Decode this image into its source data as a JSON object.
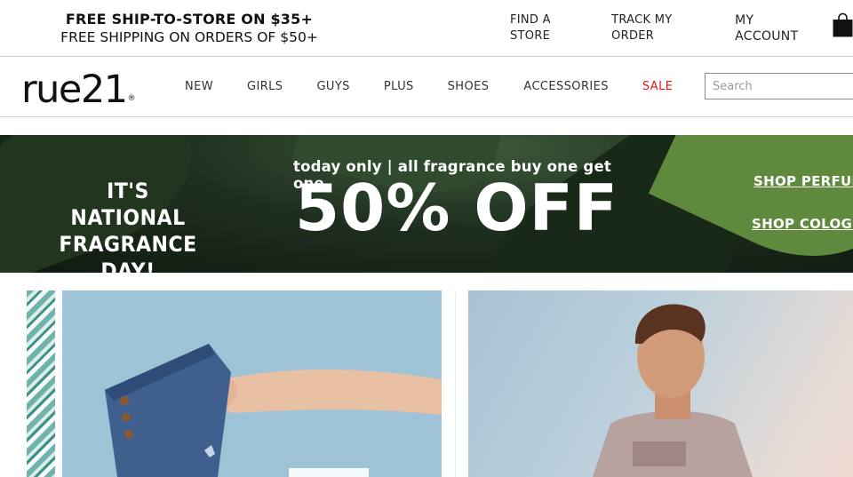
{
  "promo": {
    "line1": "FREE SHIP-TO-STORE ON $35+",
    "line2": "FREE SHIPPING ON ORDERS OF $50+"
  },
  "utility": {
    "find_store": "FIND A STORE",
    "track_order": "TRACK MY ORDER",
    "my_account": "MY ACCOUNT",
    "bag_icon": "shopping-bag-icon"
  },
  "brand": {
    "logo_text": "rue21",
    "logo_mark": "®"
  },
  "nav": {
    "items": [
      "NEW",
      "GIRLS",
      "GUYS",
      "PLUS",
      "SHOES",
      "ACCESSORIES",
      "SALE"
    ],
    "sale_color": "#e3161c"
  },
  "search": {
    "placeholder": "Search",
    "value": ""
  },
  "hero": {
    "left_line1": "IT'S NATIONAL",
    "left_line2": "FRAGRANCE DAY!",
    "sub": "today only | all fragrance buy one get one",
    "big": "50% OFF",
    "link_perfume": "SHOP PERFUM",
    "link_cologne": "SHOP COLOGN"
  },
  "colors": {
    "hero_bg": "#1e2f1f",
    "accent_red": "#e3161c"
  }
}
